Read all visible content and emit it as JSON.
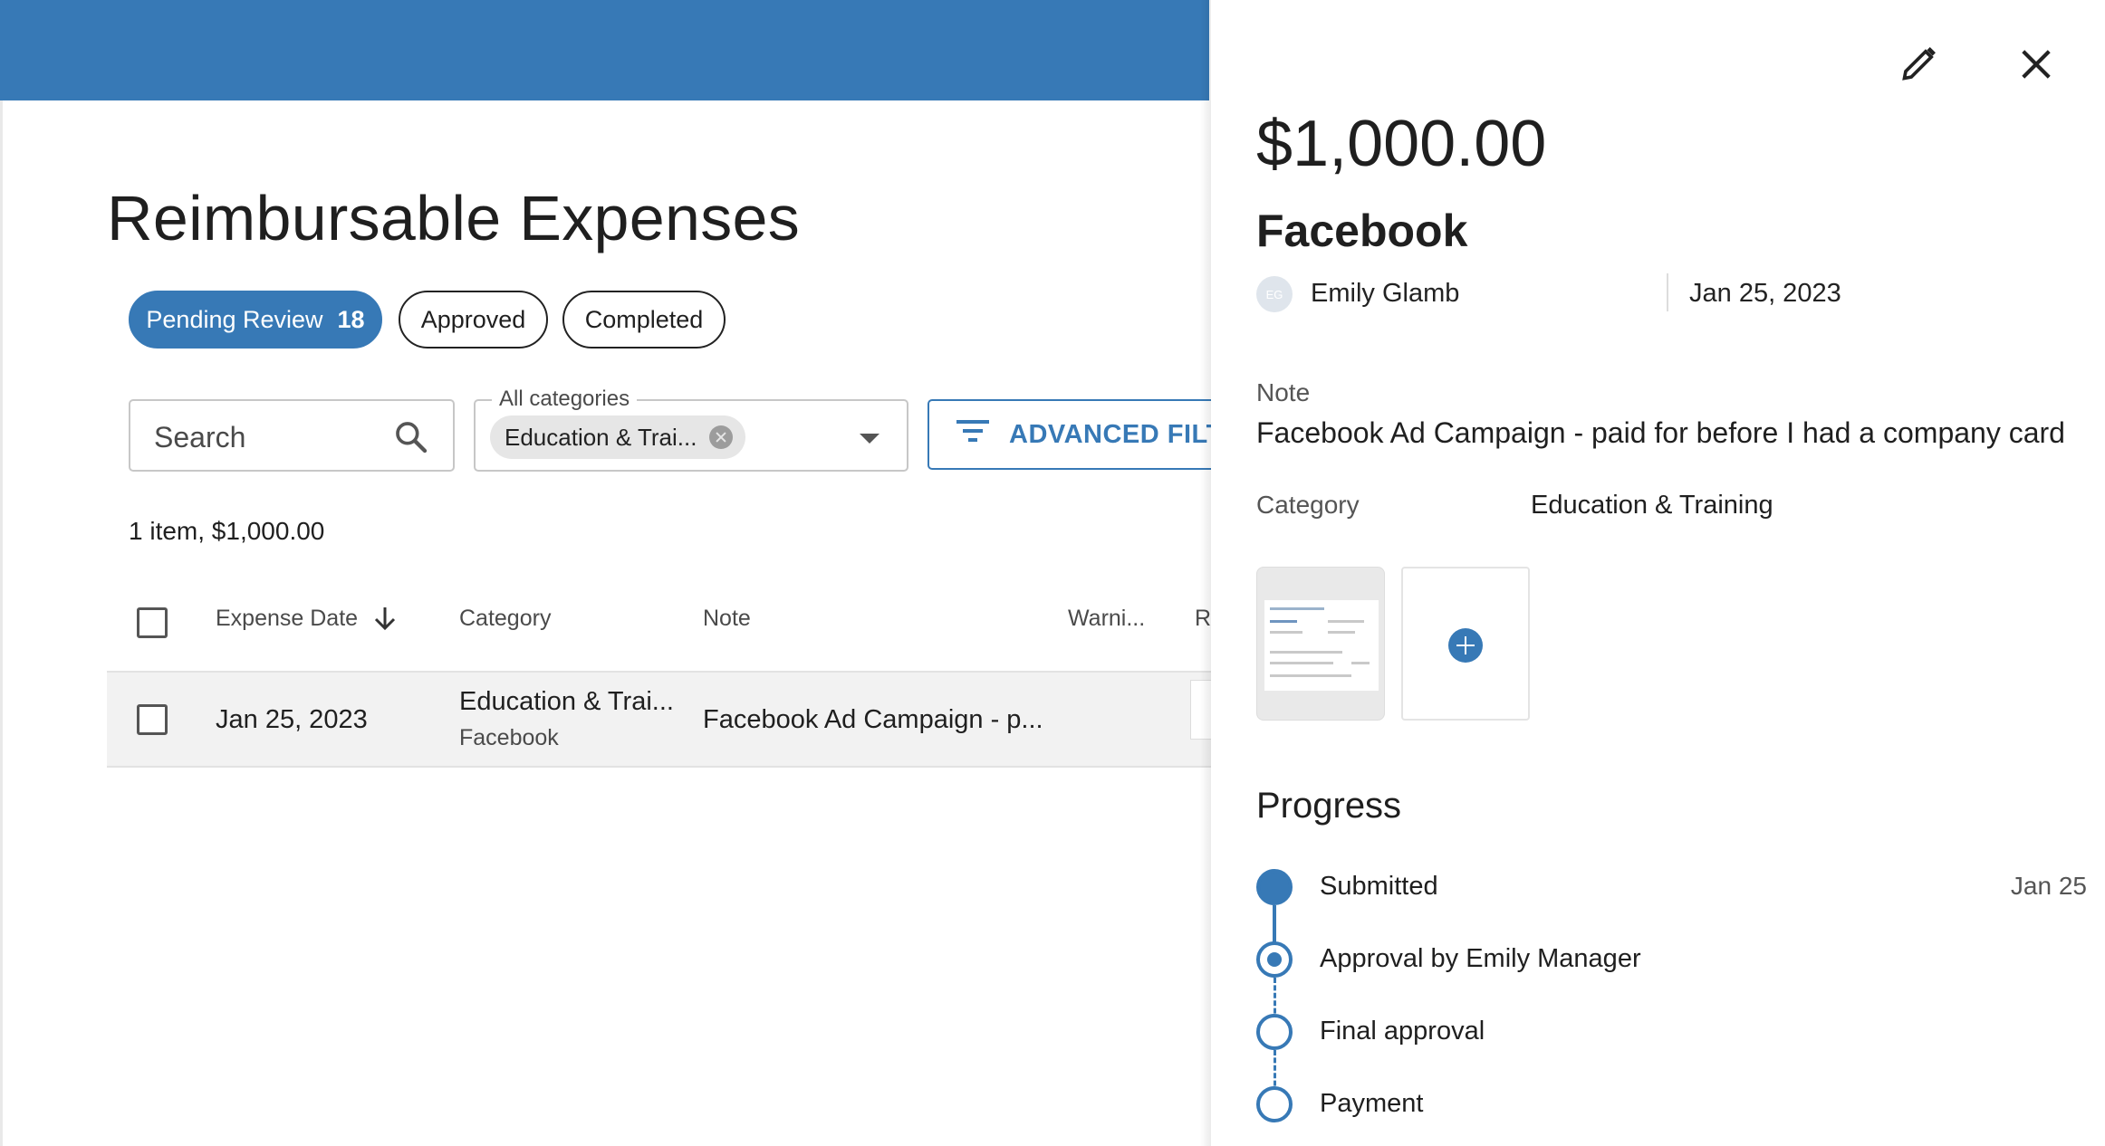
{
  "page": {
    "title": "Reimbursable Expenses",
    "tabs": [
      {
        "label": "Pending Review",
        "count": "18"
      },
      {
        "label": "Approved"
      },
      {
        "label": "Completed"
      }
    ],
    "search": {
      "placeholder": "Search"
    },
    "category_filter": {
      "legend": "All categories",
      "chip": "Education & Trai..."
    },
    "advanced_filter_label": "ADVANCED FILT",
    "summary": "1 item, $1,000.00",
    "table": {
      "columns": [
        "Expense Date",
        "Category",
        "Note",
        "Warni...",
        "Re"
      ],
      "rows": [
        {
          "date": "Jan 25, 2023",
          "category": "Education & Trai...",
          "vendor": "Facebook",
          "note": "Facebook Ad Campaign - p..."
        }
      ]
    }
  },
  "drawer": {
    "amount": "$1,000.00",
    "vendor": "Facebook",
    "user_initials": "EG",
    "user_name": "Emily Glamb",
    "date": "Jan 25, 2023",
    "note_label": "Note",
    "note_value": "Facebook Ad Campaign - paid for before I had a company card",
    "category_label": "Category",
    "category_value": "Education & Training",
    "progress_title": "Progress",
    "steps": [
      {
        "label": "Submitted",
        "date": "Jan 25",
        "state": "done"
      },
      {
        "label": "Approval by Emily Manager",
        "state": "current"
      },
      {
        "label": "Final approval",
        "state": "pending"
      },
      {
        "label": "Payment",
        "state": "pending"
      }
    ]
  },
  "colors": {
    "primary": "#3779b6"
  },
  "icons": [
    "search-icon",
    "chevron-down-icon",
    "filter-icon",
    "arrow-down-icon",
    "pencil-icon",
    "close-icon",
    "plus-icon",
    "chip-remove-icon"
  ]
}
